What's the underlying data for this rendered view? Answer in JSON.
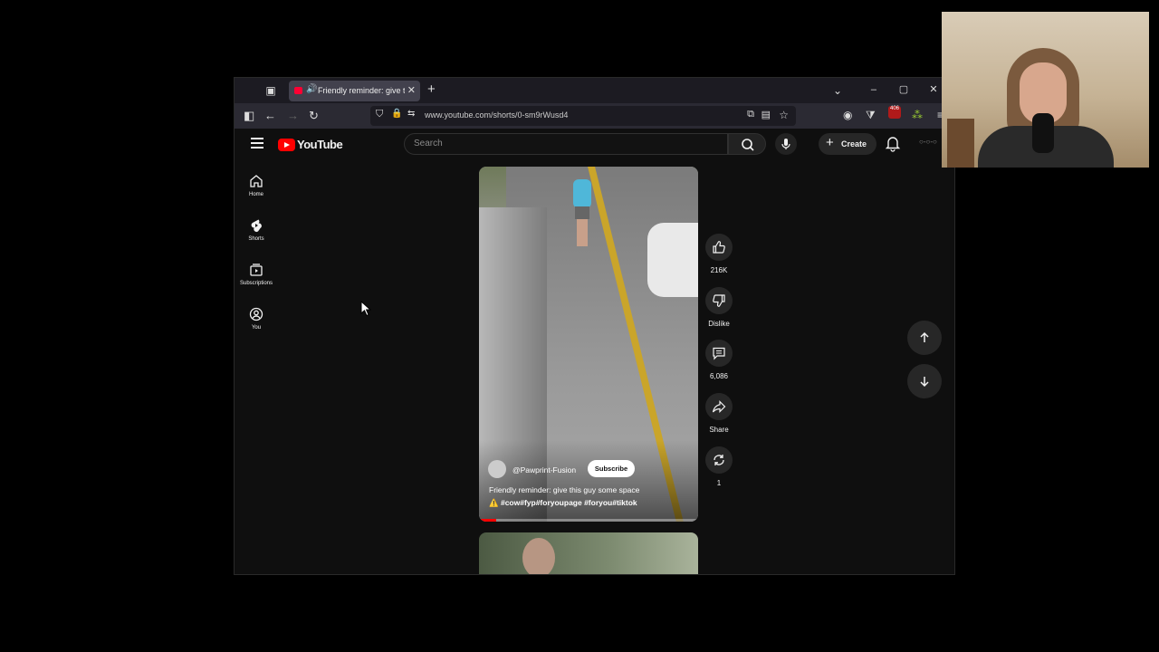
{
  "browser": {
    "tab_title": "Friendly reminder: give this guy some space",
    "url": "www.youtube.com/shorts/0-sm9rWusd4",
    "extension_badge": "406"
  },
  "youtube": {
    "brand": "YouTube",
    "search_placeholder": "Search",
    "create_label": "Create",
    "sidebar": [
      {
        "label": "Home",
        "icon": "home-icon"
      },
      {
        "label": "Shorts",
        "icon": "shorts-icon"
      },
      {
        "label": "Subscriptions",
        "icon": "subscriptions-icon"
      },
      {
        "label": "You",
        "icon": "you-icon"
      }
    ],
    "short": {
      "channel": "@Pawprint-Fusion",
      "subscribe_label": "Subscribe",
      "caption_line1": "Friendly reminder: give this guy some space",
      "caption_line2_prefix": "⚠️",
      "caption_line2": "#cow#fyp#foryoupage #foryou#tiktok",
      "progress": 0.08
    },
    "actions": {
      "likes": "216K",
      "dislike_label": "Dislike",
      "comments": "6,086",
      "share_label": "Share",
      "remix_count": "1"
    }
  },
  "colors": {
    "accent": "#ff0000",
    "background": "#0f0f0f"
  }
}
